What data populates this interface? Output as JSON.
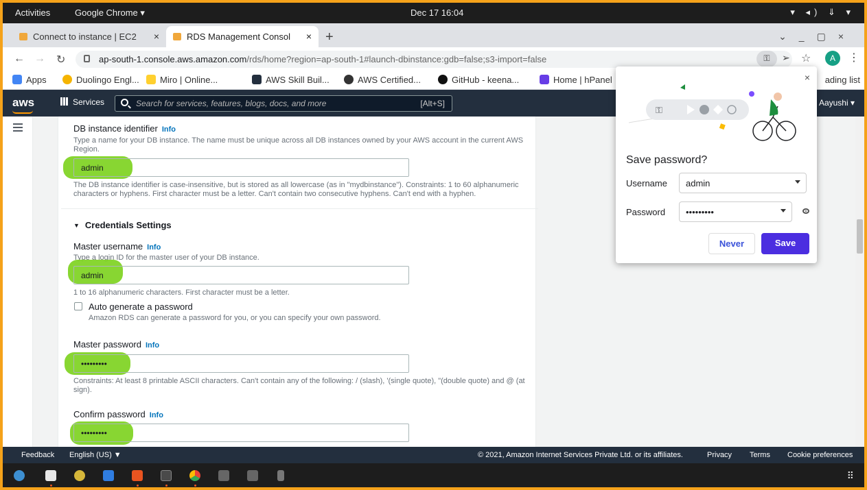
{
  "gnome": {
    "activities": "Activities",
    "app_name": "Google Chrome ▾",
    "clock": "Dec 17  16:04",
    "tray": "▾ ◂) ⇓ ▾"
  },
  "tabs": [
    {
      "title": "Connect to instance | EC2"
    },
    {
      "title": "RDS Management Consol"
    }
  ],
  "browser": {
    "url_host": "ap-south-1.console.aws.amazon.com",
    "url_path": "/rds/home?region=ap-south-1#launch-dbinstance:gdb=false;s3-import=false",
    "avatar_letter": "A"
  },
  "bookmarks": [
    {
      "label": "Apps",
      "color": "#ea4335"
    },
    {
      "label": "Duolingo Engl...",
      "color": "#f5b400"
    },
    {
      "label": "Miro | Online...",
      "color": "#ffd02f"
    },
    {
      "label": "AWS Skill Buil...",
      "color": "#232f3e"
    },
    {
      "label": "AWS Certified...",
      "color": "#333333"
    },
    {
      "label": "GitHub - keena...",
      "color": "#111111"
    },
    {
      "label": "Home | hPanel",
      "color": "#673de6"
    }
  ],
  "reading_list": "ading list",
  "aws": {
    "logo": "aws",
    "services": "Services",
    "search_placeholder": "Search for services, features, blogs, docs, and more",
    "search_shortcut": "[Alt+S]",
    "user": "Aayushi ▾"
  },
  "form": {
    "db_identifier": {
      "label": "DB instance identifier",
      "info": "Info",
      "desc": "Type a name for your DB instance. The name must be unique across all DB instances owned by your AWS account in the current AWS Region.",
      "value": "admin",
      "hint": "The DB instance identifier is case-insensitive, but is stored as all lowercase (as in \"mydbinstance\"). Constraints: 1 to 60 alphanumeric characters or hyphens. First character must be a letter. Can't contain two consecutive hyphens. Can't end with a hyphen."
    },
    "credentials_heading": "Credentials Settings",
    "master_username": {
      "label": "Master username",
      "info": "Info",
      "desc": "Type a login ID for the master user of your DB instance.",
      "value": "admin",
      "hint": "1 to 16 alphanumeric characters. First character must be a letter."
    },
    "auto_generate": {
      "label": "Auto generate a password",
      "desc": "Amazon RDS can generate a password for you, or you can specify your own password."
    },
    "master_password": {
      "label": "Master password",
      "info": "Info",
      "value": "•••••••••",
      "hint": "Constraints: At least 8 printable ASCII characters. Can't contain any of the following: / (slash), '(single quote), \"(double quote) and @ (at sign)."
    },
    "confirm_password": {
      "label": "Confirm password",
      "info": "Info",
      "value": "•••••••••"
    }
  },
  "footer": {
    "feedback": "Feedback",
    "language": "English (US) ▼",
    "copyright": "© 2021, Amazon Internet Services Private Ltd. or its affiliates.",
    "privacy": "Privacy",
    "terms": "Terms",
    "cookies": "Cookie preferences"
  },
  "save_password": {
    "title": "Save password?",
    "username_label": "Username",
    "username_value": "admin",
    "password_label": "Password",
    "password_value": "•••••••••",
    "never": "Never",
    "save": "Save"
  },
  "colors": {
    "highlight": "#7ed321",
    "aws_header": "#232f3e",
    "aws_orange": "#ff9900",
    "link_blue": "#0073bb",
    "save_button": "#4b2ee0",
    "frame_border": "#f5a21a"
  }
}
